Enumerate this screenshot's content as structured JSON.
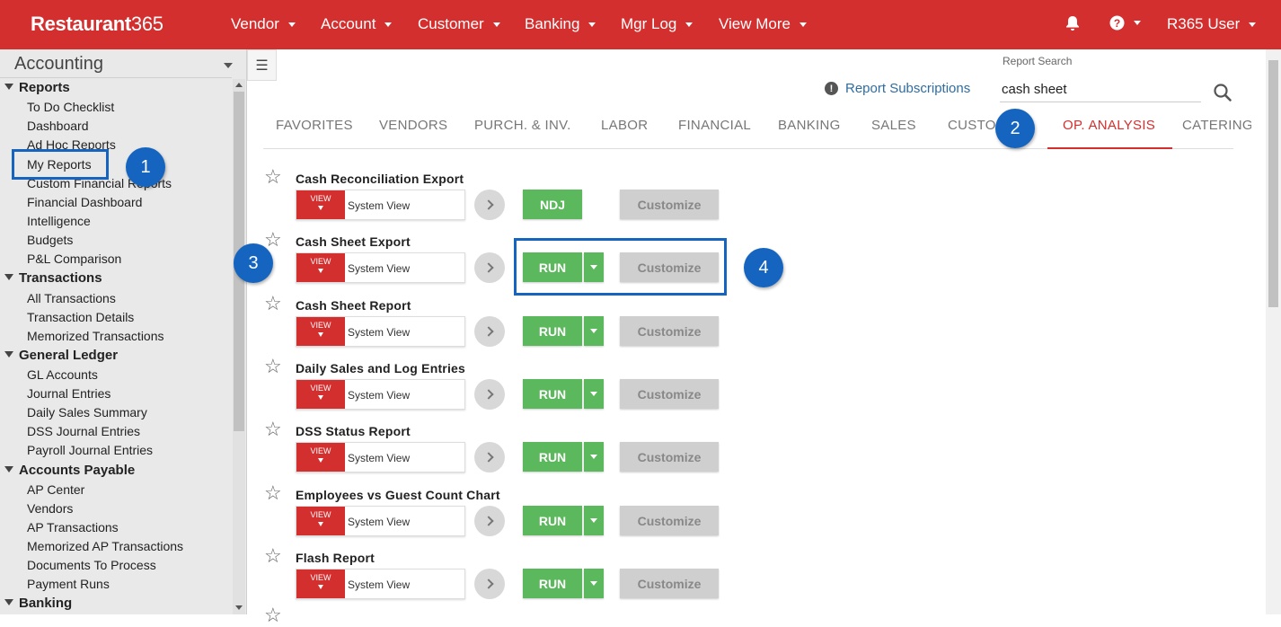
{
  "brand": {
    "name_bold": "Restaurant",
    "name_num": "365"
  },
  "topnav": {
    "items": [
      "Vendor",
      "Account",
      "Customer",
      "Banking",
      "Mgr Log",
      "View More"
    ],
    "user": "R365 User"
  },
  "sidebar": {
    "title": "Accounting",
    "sections": [
      {
        "label": "Reports",
        "items": [
          "To Do Checklist",
          "Dashboard",
          "Ad Hoc Reports",
          "My Reports",
          "Custom Financial Reports",
          "Financial Dashboard",
          "Intelligence",
          "Budgets",
          "P&L Comparison"
        ]
      },
      {
        "label": "Transactions",
        "items": [
          "All Transactions",
          "Transaction Details",
          "Memorized Transactions"
        ]
      },
      {
        "label": "General Ledger",
        "items": [
          "GL Accounts",
          "Journal Entries",
          "Daily Sales Summary",
          "DSS Journal Entries",
          "Payroll Journal Entries"
        ]
      },
      {
        "label": "Accounts Payable",
        "items": [
          "AP Center",
          "Vendors",
          "AP Transactions",
          "Memorized AP Transactions",
          "Documents To Process",
          "Payment Runs"
        ]
      },
      {
        "label": "Banking",
        "items": []
      }
    ]
  },
  "search": {
    "label": "Report Search",
    "value": "cash sheet"
  },
  "subscriptions": "Report Subscriptions",
  "tabs": [
    "FAVORITES",
    "VENDORS",
    "PURCH. & INV.",
    "LABOR",
    "FINANCIAL",
    "BANKING",
    "SALES",
    "CUSTO",
    "OP. ANALYSIS",
    "CATERING"
  ],
  "active_tab": "OP. ANALYSIS",
  "view": {
    "button": "VIEW",
    "selected": "System View"
  },
  "customize_label": "Customize",
  "reports": [
    {
      "name": "Cash Reconciliation Export",
      "action": "NDJ"
    },
    {
      "name": "Cash Sheet Export",
      "action": "RUN"
    },
    {
      "name": "Cash Sheet Report",
      "action": "RUN"
    },
    {
      "name": "Daily Sales and Log Entries",
      "action": "RUN"
    },
    {
      "name": "DSS Status Report",
      "action": "RUN"
    },
    {
      "name": "Employees vs Guest Count Chart",
      "action": "RUN"
    },
    {
      "name": "Flash Report",
      "action": "RUN"
    }
  ],
  "callouts": [
    "1",
    "2",
    "3",
    "4"
  ],
  "colors": {
    "brand_red": "#d32f2f",
    "run_green": "#5cb85c",
    "callout_blue": "#1565c0"
  }
}
